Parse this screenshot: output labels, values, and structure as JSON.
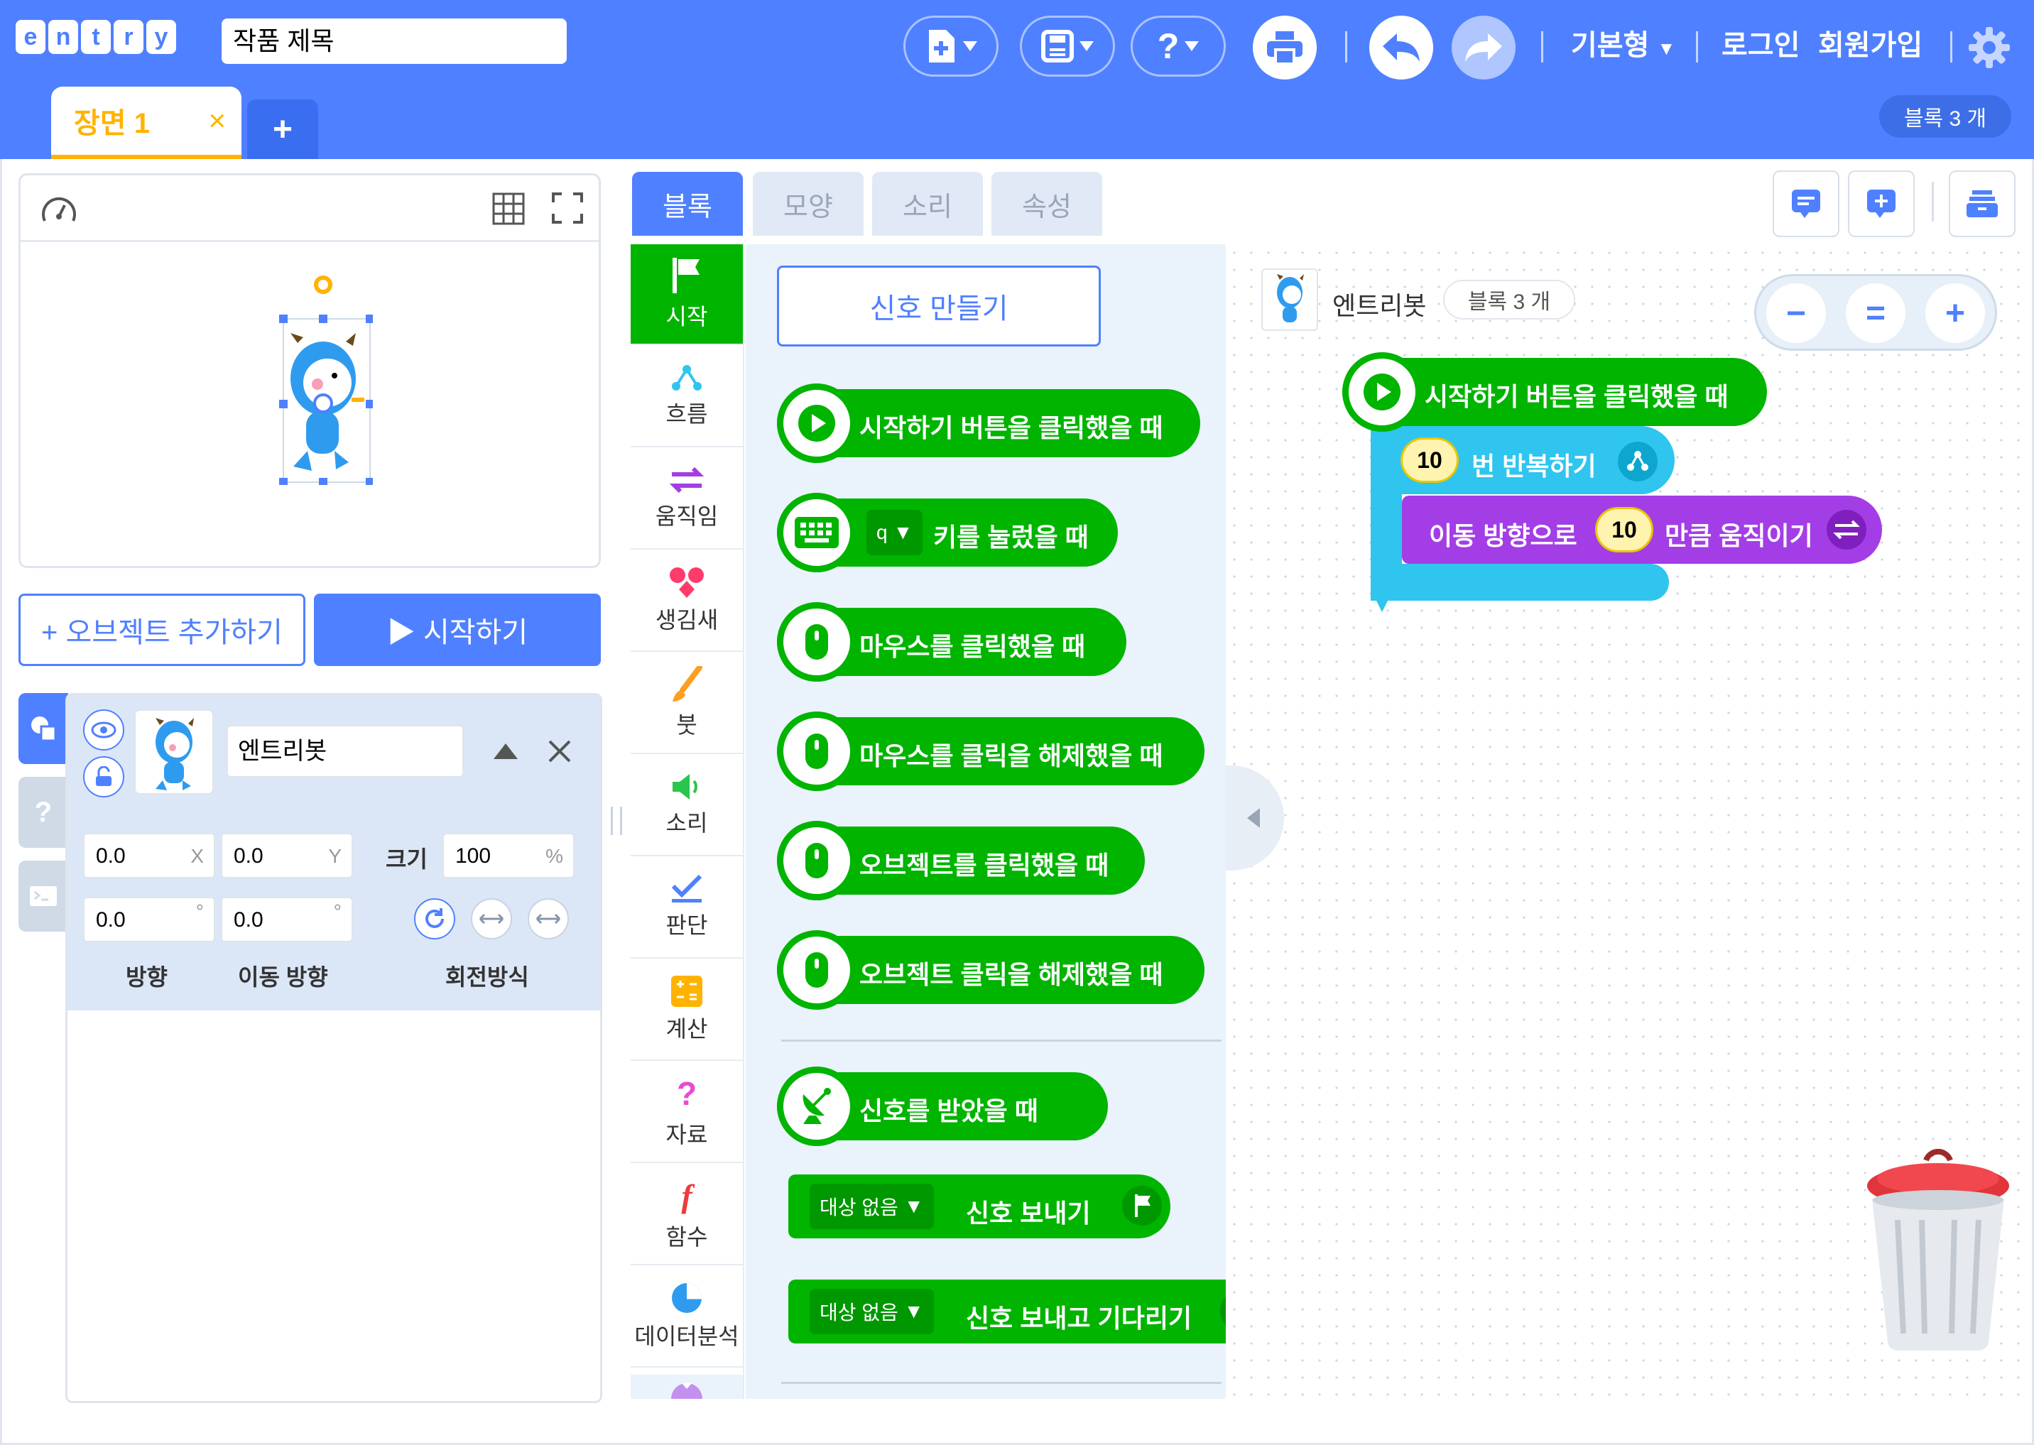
{
  "header": {
    "logo_letters": [
      "e",
      "n",
      "t",
      "r",
      "y"
    ],
    "project_title": "작품 제목",
    "mode_label": "기본형",
    "login_label": "로그인",
    "signup_label": "회원가입",
    "block_count": "블록 3 개"
  },
  "scenes": {
    "active_tab": "장면 1",
    "close_icon": "×",
    "add_icon": "+"
  },
  "stage": {
    "add_object_label": "+ 오브젝트 추가하기",
    "start_label": "▶ 시작하기"
  },
  "object": {
    "name": "엔트리봇",
    "x": "0.0",
    "x_unit": "X",
    "y": "0.0",
    "y_unit": "Y",
    "size_label": "크기",
    "size": "100",
    "size_unit": "%",
    "direction": "0.0",
    "move_direction": "0.0",
    "degree_unit": "°",
    "direction_label": "방향",
    "move_direction_label": "이동 방향",
    "rotation_label": "회전방식"
  },
  "block_tabs": [
    "블록",
    "모양",
    "소리",
    "속성"
  ],
  "categories": [
    "시작",
    "흐름",
    "움직임",
    "생김새",
    "붓",
    "소리",
    "판단",
    "계산",
    "자료",
    "함수",
    "데이터분석"
  ],
  "palette": {
    "make_signal": "신호 만들기",
    "blocks": [
      "시작하기 버튼을 클릭했을 때",
      "키를 눌렀을 때",
      "마우스를 클릭했을 때",
      "마우스를 클릭을 해제했을 때",
      "오브젝트를 클릭했을 때",
      "오브젝트 클릭을 해제했을 때",
      "신호를 받았을 때"
    ],
    "key_option": "q",
    "signal_target": "대상 없음",
    "send_signal": "신호 보내기",
    "send_signal_wait": "신호 보내고 기다리기"
  },
  "workspace": {
    "object_name": "엔트리봇",
    "block_count": "블록 3 개",
    "zoom_out": "−",
    "zoom_reset": "=",
    "zoom_in": "+",
    "script": {
      "hat": "시작하기 버튼을 클릭했을 때",
      "repeat_count": "10",
      "repeat_label": "번 반복하기",
      "move_prefix": "이동 방향으로",
      "move_amount": "10",
      "move_suffix": "만큼 움직이기"
    }
  },
  "colors": {
    "accent": "#4f80ff",
    "start_green": "#00b400",
    "flow_cyan": "#2fc5ef",
    "motion_purple": "#a33ee6",
    "scene_tab": "#ffb300"
  }
}
